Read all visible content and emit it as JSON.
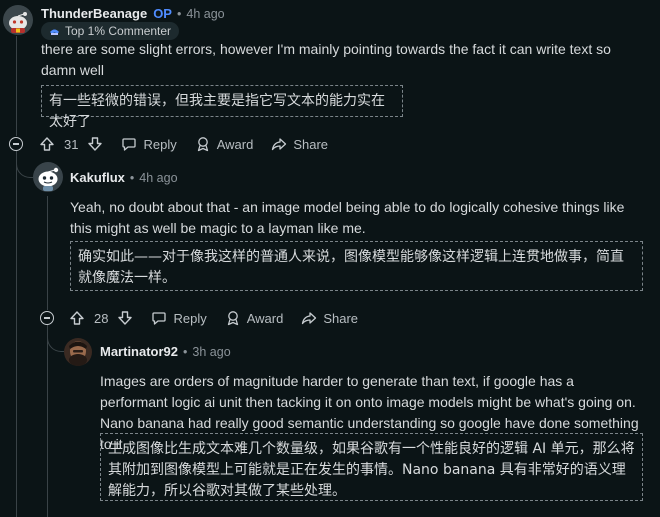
{
  "comments": [
    {
      "username": "ThunderBeanage",
      "op_badge": "OP",
      "separator": "•",
      "time": "4h ago",
      "flair": "Top 1% Commenter",
      "text": "there are some slight errors, however I'm mainly pointing towards the fact it can write text so damn well",
      "translation": "有一些轻微的错误，但我主要是指它写文本的能力实在太好了",
      "votes": "31",
      "reply": "Reply",
      "award": "Award",
      "share": "Share"
    },
    {
      "username": "Kakuflux",
      "separator": "•",
      "time": "4h ago",
      "text": "Yeah, no doubt about that - an image model being able to do logically cohesive things like this might as well be magic to a layman like me.",
      "translation": "确实如此——对于像我这样的普通人来说，图像模型能够像这样逻辑上连贯地做事，简直就像魔法一样。",
      "votes": "28",
      "reply": "Reply",
      "award": "Award",
      "share": "Share"
    },
    {
      "username": "Martinator92",
      "separator": "•",
      "time": "3h ago",
      "text": "Images are orders of magnitude harder to generate than text, if google has a performant logic ai unit then tacking it on onto image models might be what's going on. Nano banana had really good semantic understanding so google have done something to it",
      "translation": "生成图像比生成文本难几个数量级，如果谷歌有一个性能良好的逻辑 AI 单元，那么将其附加到图像模型上可能就是正在发生的事情。Nano banana 具有非常好的语义理解能力，所以谷歌对其做了某些处理。"
    }
  ],
  "colors": {
    "background": "#0b1416",
    "op_blue": "#4f8cff",
    "thread_line": "#3a4347"
  },
  "icons": [
    "snoo-avatar-icon",
    "flair-icon",
    "upvote-icon",
    "downvote-icon",
    "reply-icon",
    "award-icon",
    "share-icon",
    "collapse-icon"
  ]
}
